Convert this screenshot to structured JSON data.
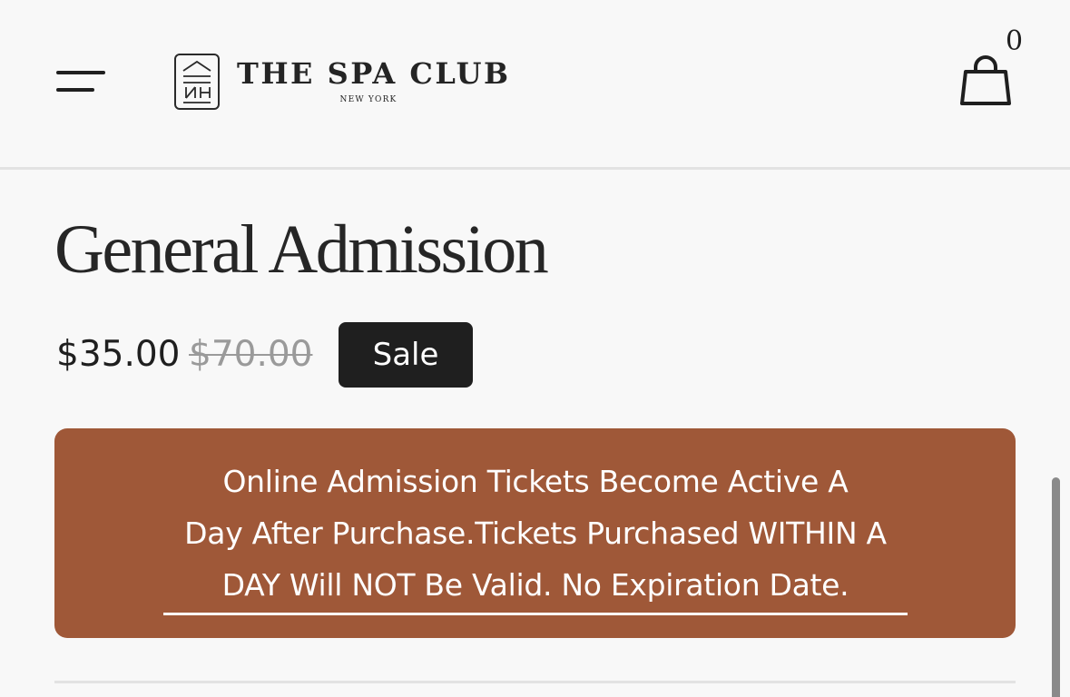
{
  "header": {
    "menu_icon": "hamburger-menu-icon",
    "logo": {
      "mark_icon": "spa-club-logo-mark",
      "name": "THE SPA CLUB",
      "subtitle": "NEW YORK"
    },
    "cart": {
      "icon": "shopping-bag-icon",
      "count": "0"
    }
  },
  "product": {
    "title": "General Admission",
    "price": "$35.00",
    "compare_price": "$70.00",
    "badge": "Sale"
  },
  "notice": {
    "lines": [
      "Online Admission Tickets Become Active A",
      "Day After Purchase.Tickets Purchased WITHIN A",
      "DAY Will NOT Be Valid. No Expiration Date."
    ],
    "background_color": "#9f5838",
    "text_color": "#ffffff"
  },
  "colors": {
    "page_background": "#f8f8f8",
    "text": "#1f1f1f",
    "badge_background": "#1f1f1f",
    "muted": "#9a9a9a"
  }
}
